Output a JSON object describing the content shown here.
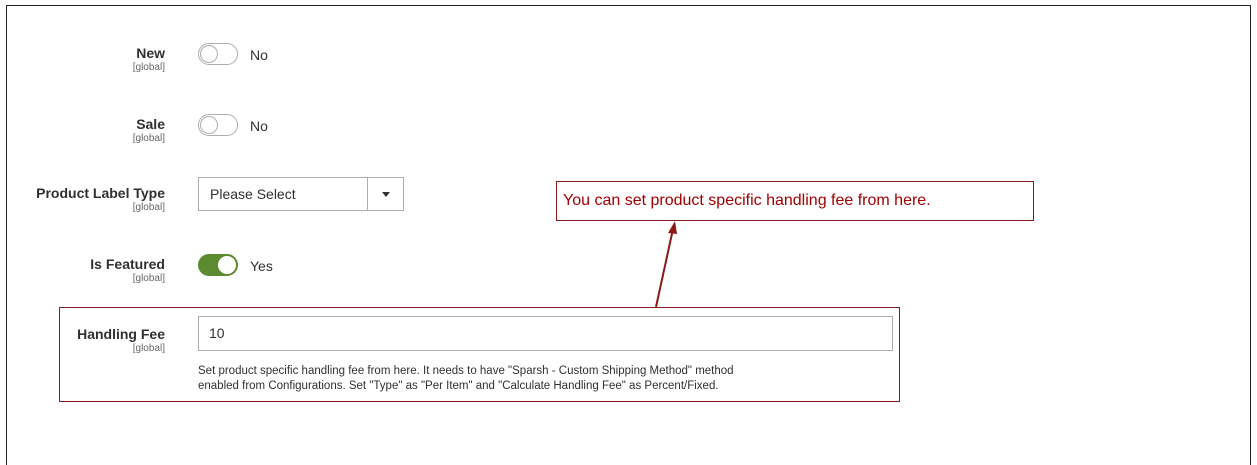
{
  "fields": {
    "new": {
      "label": "New",
      "scope": "[global]",
      "state": "No",
      "enabled": false
    },
    "sale": {
      "label": "Sale",
      "scope": "[global]",
      "state": "No",
      "enabled": false
    },
    "product_label_type": {
      "label": "Product Label Type",
      "scope": "[global]",
      "selected": "Please Select"
    },
    "is_featured": {
      "label": "Is Featured",
      "scope": "[global]",
      "state": "Yes",
      "enabled": true
    },
    "handling_fee": {
      "label": "Handling Fee",
      "scope": "[global]",
      "value": "10",
      "note_line1": "Set product specific handling fee from here. It needs to have \"Sparsh - Custom Shipping Method\" method",
      "note_line2": "enabled from Configurations. Set \"Type\" as \"Per Item\" and \"Calculate Handling Fee\" as Percent/Fixed."
    }
  },
  "annotation": {
    "callout_text": "You can set product specific handling fee from here.",
    "color": "#a30000"
  },
  "colors": {
    "toggle_on": "#5b8a2f",
    "border": "#adadad"
  }
}
